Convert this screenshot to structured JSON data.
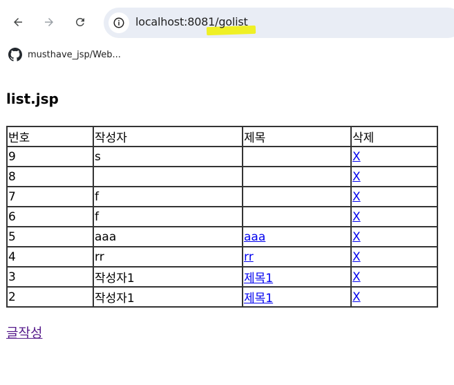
{
  "browser": {
    "url": "localhost:8081/golist",
    "bookmark_label": "musthave_jsp/Web..."
  },
  "page": {
    "title": "list.jsp",
    "write_link": "글작성"
  },
  "table": {
    "headers": [
      "번호",
      "작성자",
      "제목",
      "삭제"
    ],
    "rows": [
      {
        "no": "9",
        "writer": "s",
        "title": "",
        "del": "X"
      },
      {
        "no": "8",
        "writer": "",
        "title": "",
        "del": "X"
      },
      {
        "no": "7",
        "writer": "f",
        "title": "",
        "del": "X"
      },
      {
        "no": "6",
        "writer": "f",
        "title": "",
        "del": "X"
      },
      {
        "no": "5",
        "writer": "aaa",
        "title": "aaa",
        "del": "X"
      },
      {
        "no": "4",
        "writer": "rr",
        "title": "rr",
        "del": "X"
      },
      {
        "no": "3",
        "writer": "작성자1",
        "title": "제목1",
        "del": "X"
      },
      {
        "no": "2",
        "writer": "작성자1",
        "title": "제목1",
        "del": "X"
      }
    ]
  },
  "colors": {
    "link": "#0000ee",
    "visited_link": "#551a8b",
    "url_highlight": "#f0f000"
  }
}
